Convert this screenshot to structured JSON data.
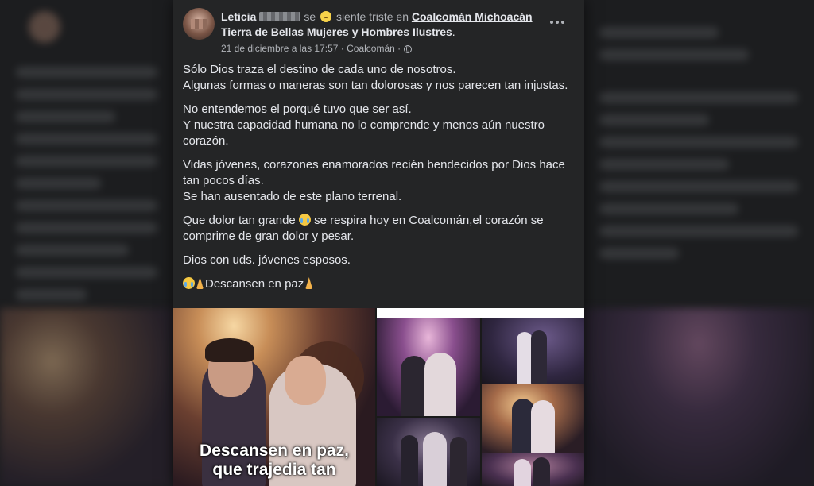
{
  "post": {
    "author_name": "Leticia",
    "feeling_text": "se",
    "feeling_suffix": "siente triste en",
    "location": "Coalcomán Michoacán Tierra de Bellas Mujeres y Hombres Ilustres",
    "location_end": ".",
    "timestamp": "21 de diciembre a las 17:57",
    "place_meta": "Coalcomán",
    "more_icon": "more-horizontal-icon",
    "paragraphs": [
      [
        "Sólo Dios traza el destino de cada uno de nosotros.",
        "Algunas formas o maneras son tan dolorosas y nos parecen tan injustas."
      ],
      [
        "No entendemos el porqué tuvo que ser así.",
        "Y nuestra capacidad humana no lo comprende y menos aún nuestro corazón."
      ],
      [
        "Vidas jóvenes, corazones enamorados recién bendecidos por Dios hace tan pocos días.",
        "Se han ausentado de este plano terrenal."
      ],
      [
        "Que dolor tan grande",
        "se respira hoy en Coalcomán,el corazón se comprime de gran dolor y pesar."
      ],
      [
        "Dios con uds. jóvenes esposos."
      ],
      [
        "Descansen en paz"
      ]
    ],
    "photo_caption_line1": "Descansen en paz,",
    "photo_caption_line2": "que trajedia tan"
  },
  "colors": {
    "card_bg": "#242526",
    "page_bg": "#1c1d1f",
    "text_primary": "#e4e6eb",
    "text_secondary": "#b0b3b8"
  }
}
